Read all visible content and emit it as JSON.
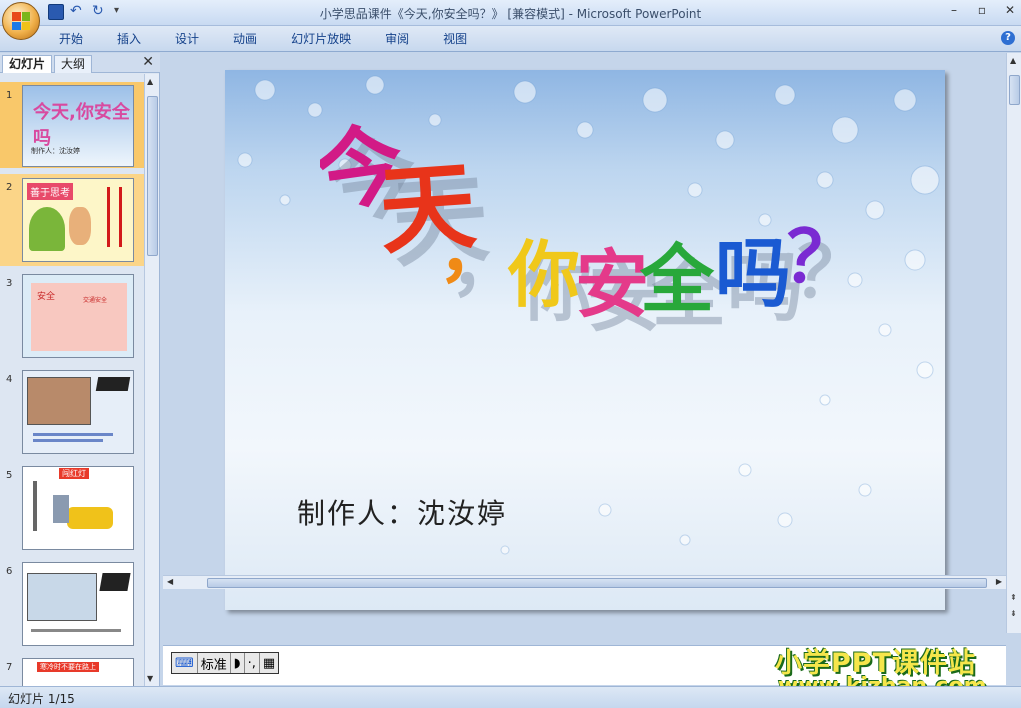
{
  "window": {
    "title": "小学思品课件《今天,你安全吗？》 [兼容模式] - Microsoft PowerPoint",
    "controls": [
      "–",
      "▫",
      "✕"
    ]
  },
  "ribbon": {
    "tabs": [
      "开始",
      "插入",
      "设计",
      "动画",
      "幻灯片放映",
      "审阅",
      "视图"
    ]
  },
  "left_panel": {
    "tabs": [
      "幻灯片",
      "大纲"
    ],
    "close": "✕",
    "thumbnails": [
      {
        "num": "1",
        "caption": "制作人：沈汝婷"
      },
      {
        "num": "2",
        "caption": "善于思考"
      },
      {
        "num": "3",
        "caption": "交通安全"
      },
      {
        "num": "4",
        "caption": ""
      },
      {
        "num": "5",
        "caption": "闯红灯"
      },
      {
        "num": "6",
        "caption": ""
      },
      {
        "num": "7",
        "caption": "寒冷时不要在路上"
      }
    ]
  },
  "slide": {
    "title_chars": [
      "今",
      "天",
      "，",
      "你",
      "安",
      "全",
      "吗",
      "？"
    ],
    "author": "制作人：沈汝婷"
  },
  "ime": {
    "label": "标准"
  },
  "watermark": {
    "line1": "小学PPT课件站",
    "line2": "www.kjzhan.com"
  },
  "status": {
    "text": "幻灯片 1/15"
  },
  "colors": {
    "title": [
      "#d21a86",
      "#e8341a",
      "#f08a16",
      "#f0c81a",
      "#e43a8a",
      "#28a83a",
      "#1a5ad2",
      "#7a2ad2"
    ]
  }
}
